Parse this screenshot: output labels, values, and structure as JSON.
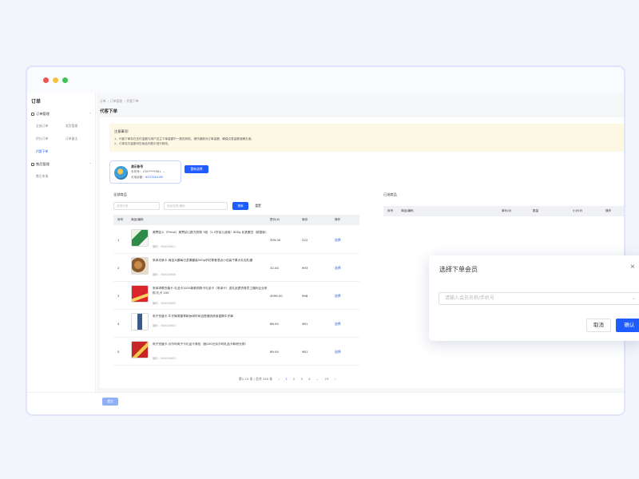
{
  "sidebar": {
    "title": "订单",
    "groups": [
      {
        "label": "订单管理",
        "items": [
          "全部订单",
          "发货管理",
          "积分订单",
          "订单备注...",
          "代客下单"
        ]
      },
      {
        "label": "售后管理",
        "items": [
          "售后申请"
        ]
      }
    ],
    "active_item": "代客下单"
  },
  "breadcrumb": [
    "订单",
    "订单管理",
    "代客下单"
  ],
  "page_title": "代客下单",
  "notice": {
    "title": "注意事项:",
    "lines": [
      "1、代客下单存在支付金额与用户店主下单金额不一致的风险，请仔细核对订单金额，确保交易金额准确无误。",
      "2、订单支付金额可在商品列表中进行修改。"
    ]
  },
  "member": {
    "name": "演示账号",
    "phone_label": "手机号：",
    "phone": "150****9981",
    "balance_label": "可用余额：",
    "balance": "¥237243.08",
    "reselect": "重新选择"
  },
  "all_products": {
    "title": "全部商品",
    "category_placeholder": "选择分类",
    "search_placeholder": "商品名称/编码",
    "search_btn": "搜索",
    "reset_btn": "重置",
    "columns": [
      "序号",
      "商品/编码",
      "售价(¥)",
      "库存",
      "操作"
    ],
    "rows": [
      {
        "idx": "1",
        "name": "美赞臣人（Prinst）美赞幼儿配方奶粉 3段（1-3岁幼儿适用）800g 乳铁蛋白（新国标）",
        "code": "编码：SN0000611",
        "price": "309.00",
        "stock": "222",
        "op": "选择"
      },
      {
        "idx": "2",
        "name": "采泽光焕卡-商品大鹏每日坚果罐装500g孕妇零食混合小包装干果大礼包礼罐",
        "code": "编码：SN0000606",
        "price": "32.00",
        "stock": "993",
        "op": "选择"
      },
      {
        "idx": "3",
        "name": "采泽求联充值卡-礼品卡2025新款购物卡礼品卡（采泽卡）送礼品提货券员工福利企业采购 礼卡 100",
        "code": "编码：SN0000605",
        "price": "4599.00",
        "stock": "998",
        "op": "选择"
      },
      {
        "idx": "4",
        "name": "电子充值卡-牛仔裤男春季款休闲时尚百搭潮流修身直筒牛仔裤",
        "code": "编码：SN0000604",
        "price": "68.00",
        "stock": "981",
        "op": "选择"
      },
      {
        "idx": "5",
        "name": "电子充值卡-沃尔玛电子卡礼品卡券包（面100元沃尔玛礼品卡和积分券）",
        "code": "编码：SN0000603",
        "price": "89.00",
        "stock": "981",
        "op": "选择"
      }
    ],
    "pagination": {
      "summary": "第1-15 条 / 总共 345 条",
      "prev": "‹",
      "pages": [
        "1",
        "2",
        "3",
        "4",
        "...",
        "23"
      ],
      "next": "›",
      "current": "1"
    }
  },
  "selected_products": {
    "title": "已选商品",
    "columns": [
      "序号",
      "商品/编码",
      "单价(¥)",
      "数量",
      "小计(¥)",
      "操作"
    ]
  },
  "footer": {
    "submit": "提交"
  },
  "modal": {
    "title": "选择下单会员",
    "placeholder": "请输入会员名称/手机号",
    "cancel": "取消",
    "confirm": "确认",
    "close_icon": "close-icon"
  },
  "colors": {
    "accent": "#1e5cff",
    "notice_bg": "#fdf8e3",
    "page_bg": "#f3f5fc"
  }
}
